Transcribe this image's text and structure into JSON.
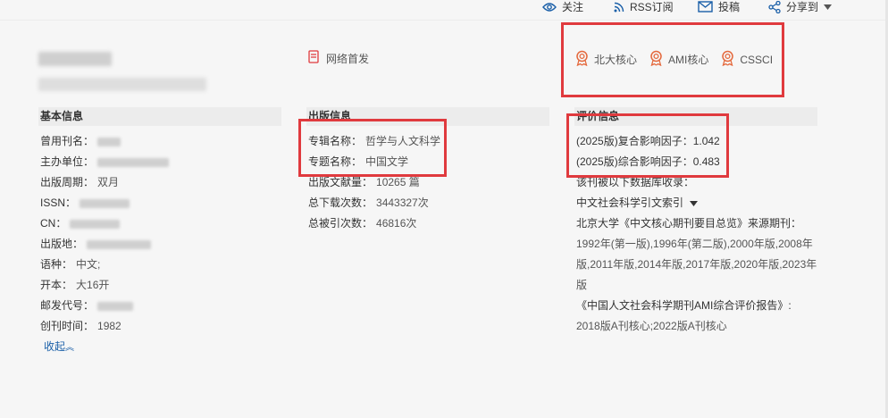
{
  "toolbar": {
    "follow": "关注",
    "rss": "RSS订阅",
    "submit": "投稿",
    "share": "分享到"
  },
  "journal": {
    "online_first": "网络首发",
    "badges": [
      "北大核心",
      "AMI核心",
      "CSSCI"
    ]
  },
  "basic_info": {
    "title": "基本信息",
    "rows": [
      {
        "label": "曾用刊名：",
        "value": ""
      },
      {
        "label": "主办单位：",
        "value": ""
      },
      {
        "label": "出版周期：",
        "value": "双月"
      },
      {
        "label": "ISSN：",
        "value": ""
      },
      {
        "label": "CN：",
        "value": ""
      },
      {
        "label": "出版地：",
        "value": ""
      },
      {
        "label": "语种：",
        "value": "中文;"
      },
      {
        "label": "开本：",
        "value": "大16开"
      },
      {
        "label": "邮发代号：",
        "value": ""
      },
      {
        "label": "创刊时间：",
        "value": "1982"
      }
    ],
    "collapse": "收起"
  },
  "publication_info": {
    "title": "出版信息",
    "rows": [
      {
        "label": "专辑名称：",
        "value": "哲学与人文科学"
      },
      {
        "label": "专题名称：",
        "value": "中国文学"
      },
      {
        "label": "出版文献量：",
        "value": "10265 篇"
      },
      {
        "label": "总下载次数：",
        "value": "3443327次"
      },
      {
        "label": "总被引次数：",
        "value": "46816次"
      }
    ]
  },
  "evaluation_info": {
    "title": "评价信息",
    "impact_composite": "(2025版)复合影响因子：1.042",
    "impact_comprehensive": "(2025版)综合影响因子：0.483",
    "indexed_by": "该刊被以下数据库收录：",
    "database": "中文社会科学引文索引",
    "pku_source": "北京大学《中文核心期刊要目总览》来源期刊：",
    "pku_years_1": "1992年(第一版),1996年(第二版),2000年版,2008年",
    "pku_years_2": "版,2011年版,2014年版,2017年版,2020年版,2023年",
    "pku_years_3": "版",
    "ami_report": "《中国人文社会科学期刊AMI综合评价报告》:",
    "ami_years": "2018版A刊核心;2022版A刊核心"
  },
  "colors": {
    "accent_blue": "#1a5fa8",
    "highlight_red": "#e03a3e",
    "badge_orange": "#e4683c"
  }
}
